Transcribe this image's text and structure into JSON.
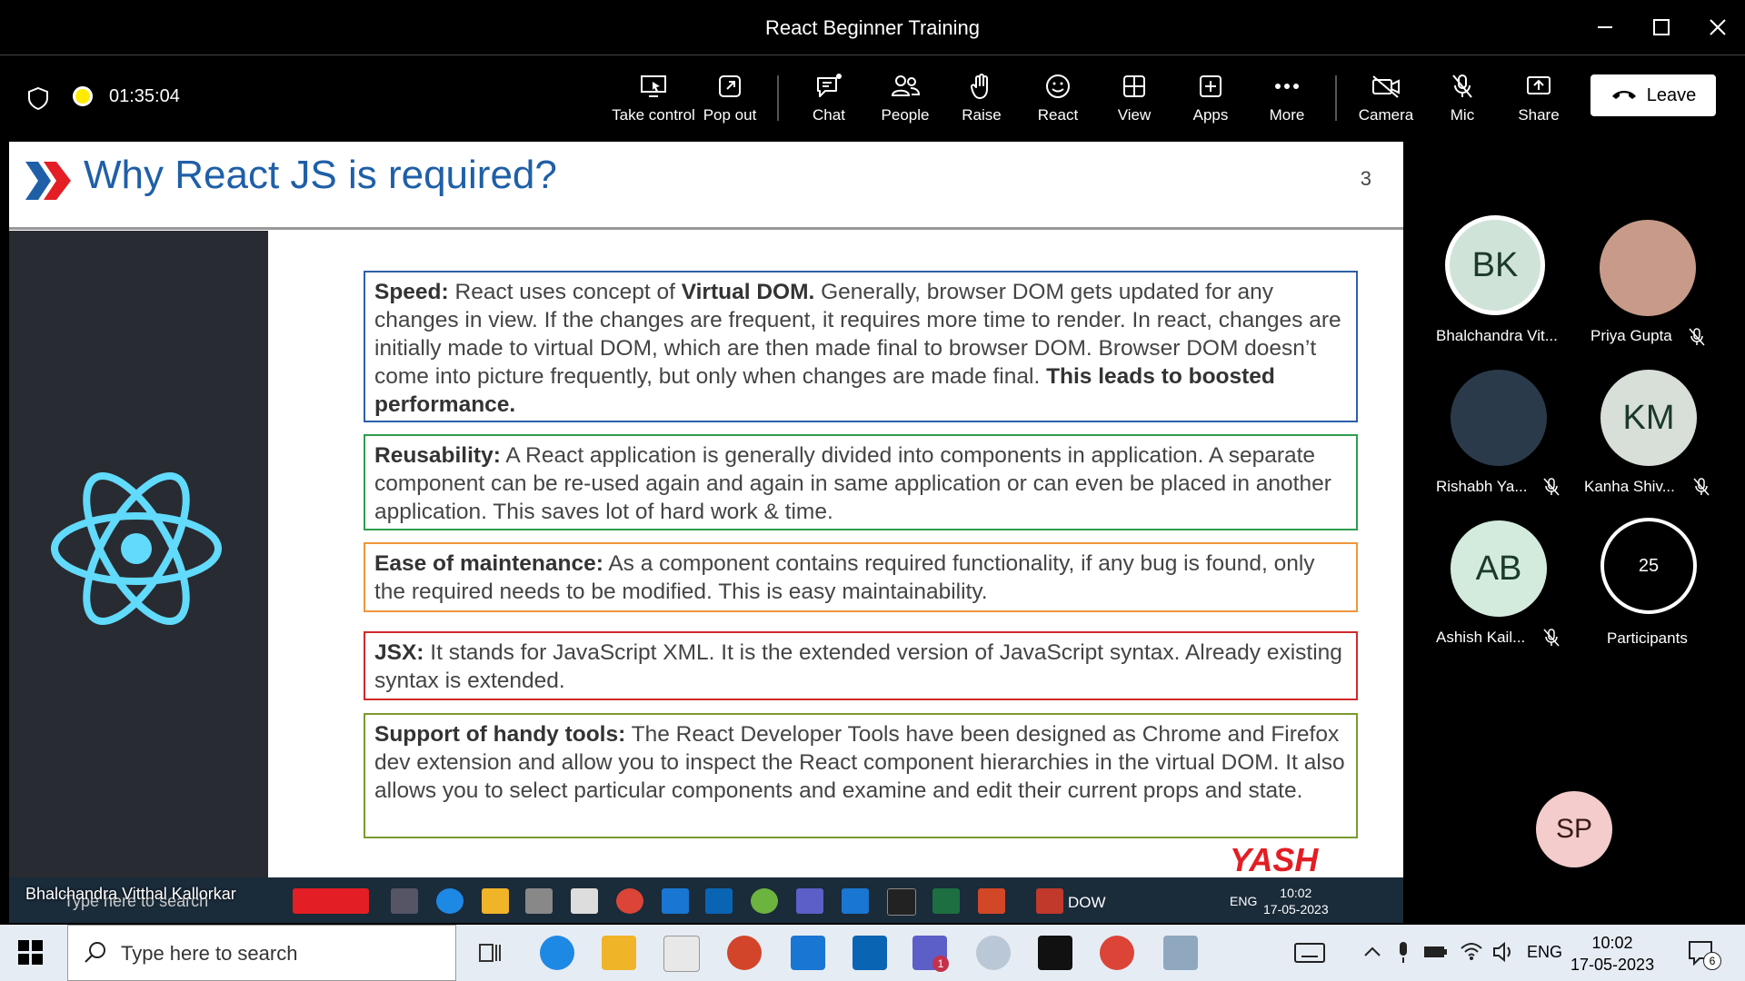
{
  "window": {
    "title": "React Beginner Training"
  },
  "meeting": {
    "timer": "01:35:04"
  },
  "toolbar": {
    "take_control": "Take control",
    "pop_out": "Pop out",
    "chat": "Chat",
    "people": "People",
    "raise": "Raise",
    "react": "React",
    "view": "View",
    "apps": "Apps",
    "more": "More",
    "camera": "Camera",
    "mic": "Mic",
    "share": "Share",
    "leave": "Leave"
  },
  "slide": {
    "title": "Why React JS is required?",
    "number": "3",
    "boxes": [
      {
        "heading": "Speed:",
        "text1": " React uses concept of ",
        "bold1": "Virtual DOM.",
        "text2": " Generally, browser DOM gets updated for any changes in view. If the changes are frequent, it requires more time to render. In react, changes are initially made to virtual DOM, which are then made final to browser DOM. Browser DOM doesn’t come into picture frequently, but only when changes are made final. ",
        "bold2": "This leads to boosted performance.",
        "color": "#2e5fa8"
      },
      {
        "heading": "Reusability:",
        "text": " A React application is generally divided into components in application. A separate component can be re-used again and again in same application or can even be placed in another application. This saves lot of hard work & time.",
        "color": "#2e9e4e"
      },
      {
        "heading": "Ease of maintenance:",
        "text": " As a component contains required functionality, if any bug is found, only the required needs to be modified. This is easy maintainability.",
        "color": "#f0963c"
      },
      {
        "heading": "JSX:",
        "text": " It stands for JavaScript XML. It is the extended version of JavaScript syntax. Already existing syntax is extended.",
        "color": "#d02a2a"
      },
      {
        "heading": "Support of handy tools:",
        "text": " The React Developer Tools have been designed as Chrome and Firefox dev extension and allow you to inspect the React component hierarchies in the virtual DOM. It also allows you to select particular components and examine and edit their current props and state.",
        "color": "#7a9a2e"
      }
    ],
    "logo_text": "YASH"
  },
  "shared_screen": {
    "presenter": "Bhalchandra Vitthal Kallorkar",
    "search_placeholder": "Type here to search",
    "dow": "DOW",
    "lang": "ENG",
    "time": "10:02",
    "date": "17-05-2023"
  },
  "participants": [
    {
      "initials": "BK",
      "name": "Bhalchandra Vit...",
      "muted": false
    },
    {
      "initials": "",
      "name": "Priya Gupta",
      "muted": true
    },
    {
      "initials": "",
      "name": "Rishabh Ya...",
      "muted": true
    },
    {
      "initials": "KM",
      "name": "Kanha Shiv...",
      "muted": true
    },
    {
      "initials": "AB",
      "name": "Ashish Kail...",
      "muted": true
    },
    {
      "initials": "25",
      "name": "Participants",
      "muted": false
    },
    {
      "initials": "SP",
      "name": "",
      "muted": false
    }
  ],
  "taskbar": {
    "search_placeholder": "Type here to search",
    "lang": "ENG",
    "time": "10:02",
    "date": "17-05-2023",
    "notification_count": "6",
    "teams_badge": "1"
  },
  "colors": {
    "accent_title": "#1f5fa8",
    "react_logo": "#61dafb",
    "record_dot": "#ffeb00"
  }
}
